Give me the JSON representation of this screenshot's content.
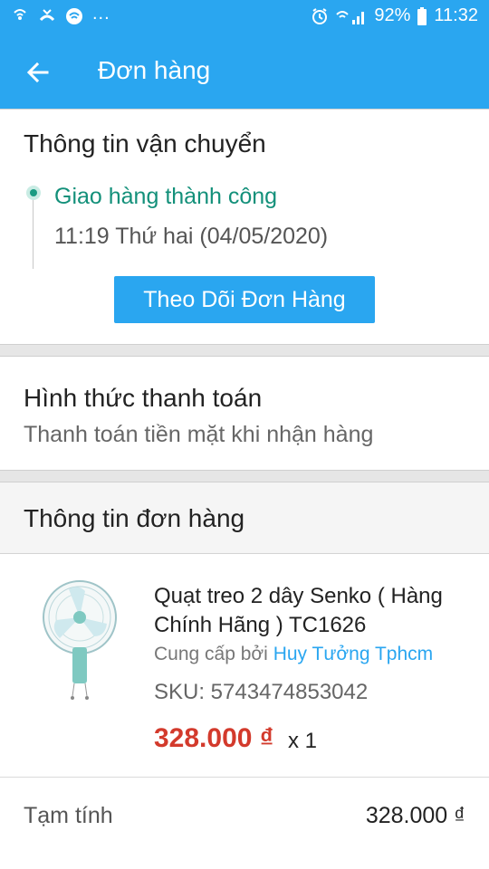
{
  "status_bar": {
    "left_icons": [
      "wifi-call-icon",
      "missed-call-icon",
      "wifi-icon"
    ],
    "dots": "...",
    "alarm_icon": "alarm-icon",
    "signal_icon": "signal-icon",
    "battery": "92%",
    "time": "11:32"
  },
  "header": {
    "title": "Đơn hàng",
    "back_icon": "arrow-left-icon"
  },
  "shipping": {
    "title": "Thông tin vận chuyển",
    "status": "Giao hàng thành công",
    "time": "11:19 Thứ hai (04/05/2020)",
    "track_button": "Theo Dõi Đơn Hàng"
  },
  "payment": {
    "title": "Hình thức thanh toán",
    "method": "Thanh toán tiền mặt khi nhận hàng"
  },
  "order": {
    "title": "Thông tin đơn hàng",
    "product": {
      "name": "Quạt treo 2 dây Senko ( Hàng Chính Hãng ) TC1626",
      "supplier_prefix": "Cung cấp bởi",
      "supplier_name": "Huy Tưởng Tphcm",
      "sku": "SKU: 5743474853042",
      "price": "328.000 ₫",
      "quantity": "x 1",
      "image_icon": "wall-fan-image"
    },
    "subtotal_label": "Tạm tính",
    "subtotal_value": "328.000 ₫"
  },
  "colors": {
    "primary": "#2aa6f0",
    "success": "#13907a",
    "price": "#d33a2c"
  }
}
